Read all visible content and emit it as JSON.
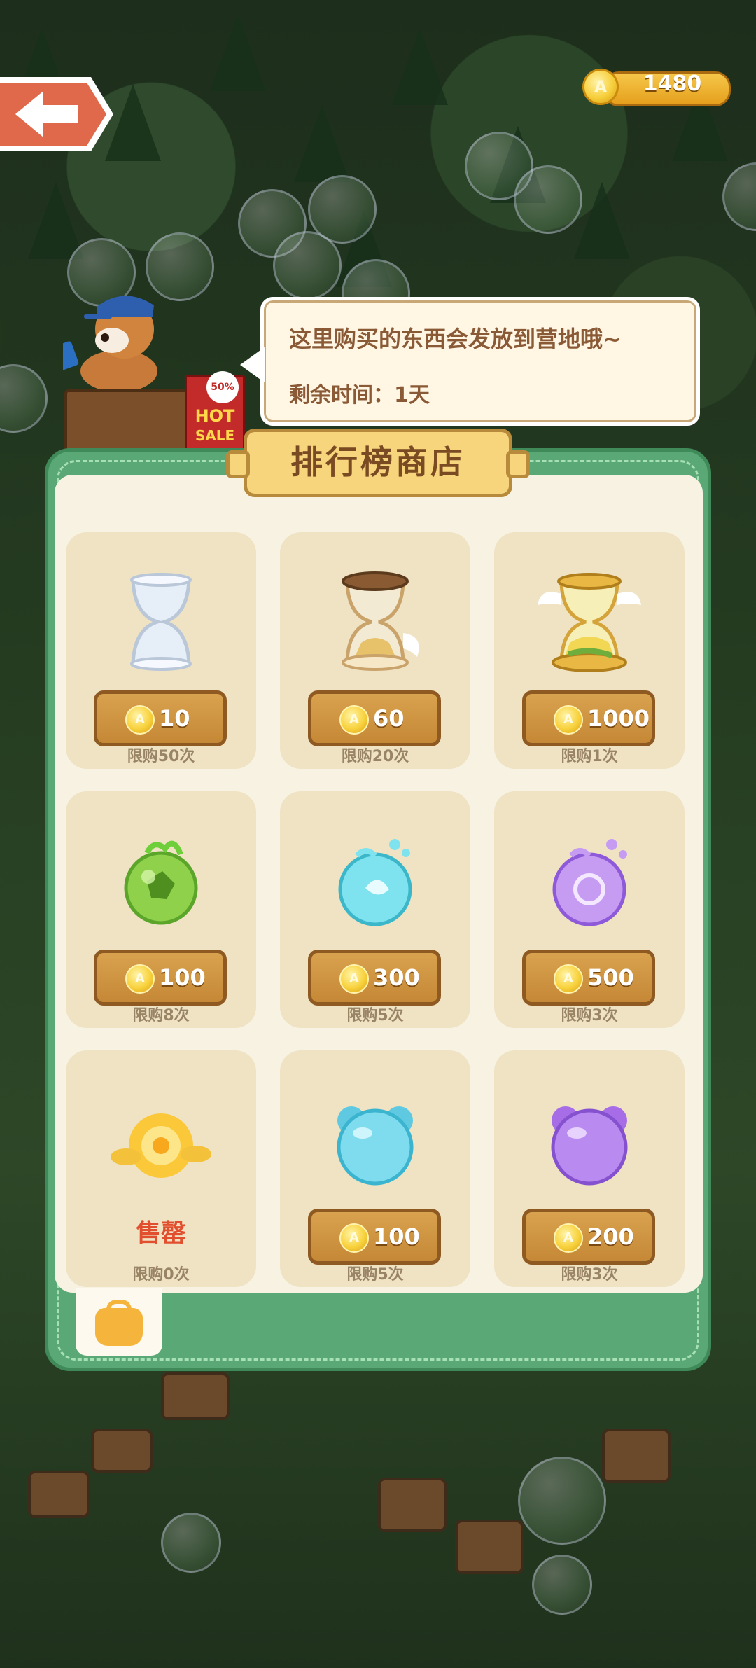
{
  "header": {
    "coin_balance": "1480"
  },
  "shopkeeper": {
    "sign_discount": "50% OFF",
    "sign_hot": "HOT",
    "sign_sale": "SALE"
  },
  "speech": {
    "line1": "这里购买的东西会发放到营地哦~",
    "line2": "剩余时间：1天"
  },
  "shop": {
    "title": "排行榜商店",
    "items": [
      {
        "name": "hourglass-clear",
        "price": "10",
        "limit": "限购50次"
      },
      {
        "name": "hourglass-wood",
        "price": "60",
        "limit": "限购20次"
      },
      {
        "name": "hourglass-golden-winged",
        "price": "1000",
        "limit": "限购1次"
      },
      {
        "name": "orb-green",
        "price": "100",
        "limit": "限购8次"
      },
      {
        "name": "orb-cyan",
        "price": "300",
        "limit": "限购5次"
      },
      {
        "name": "orb-purple",
        "price": "500",
        "limit": "限购3次"
      },
      {
        "name": "rose-golden",
        "status": "售罄",
        "limit": "限购0次"
      },
      {
        "name": "bear-jelly-blue",
        "price": "100",
        "limit": "限购5次"
      },
      {
        "name": "bear-jelly-purple",
        "price": "200",
        "limit": "限购3次"
      }
    ]
  },
  "colors": {
    "panel_green": "#5aa875",
    "card_bg": "#efe3c4",
    "price_btn": "#c58836",
    "soldout_red": "#e24f2e"
  }
}
